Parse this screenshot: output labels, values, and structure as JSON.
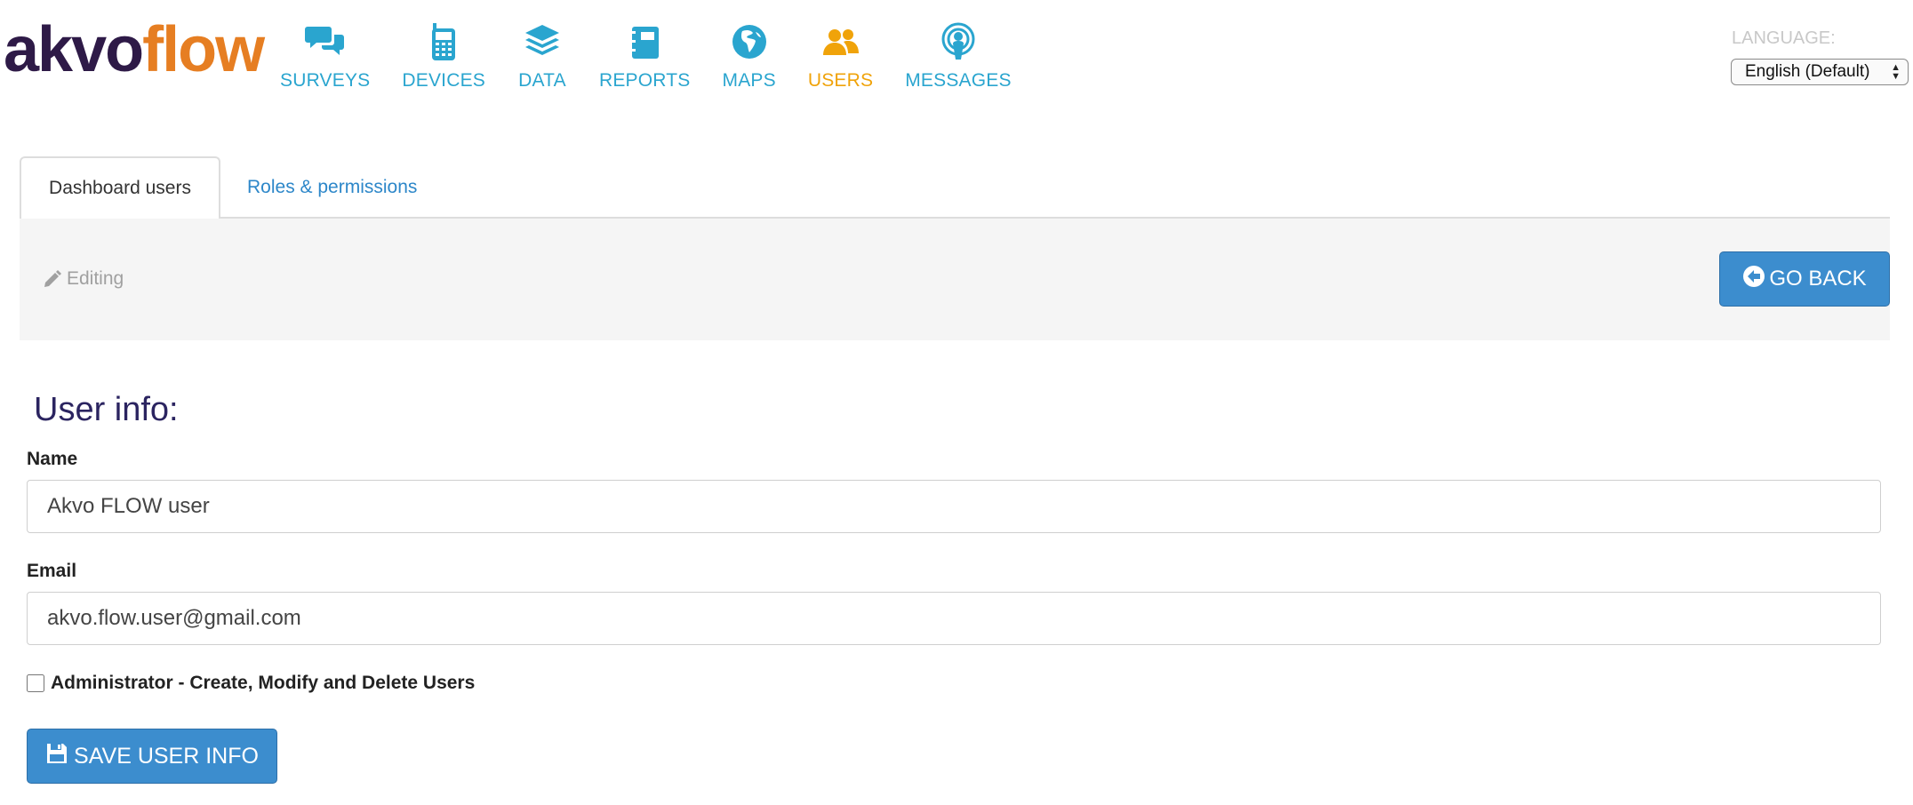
{
  "logo": {
    "part1": "akvo",
    "part2": "flow"
  },
  "nav": {
    "items": [
      {
        "label": "SURVEYS",
        "icon": "surveys-icon"
      },
      {
        "label": "DEVICES",
        "icon": "devices-icon"
      },
      {
        "label": "DATA",
        "icon": "data-icon"
      },
      {
        "label": "REPORTS",
        "icon": "reports-icon"
      },
      {
        "label": "MAPS",
        "icon": "maps-icon"
      },
      {
        "label": "USERS",
        "icon": "users-icon",
        "active": true
      },
      {
        "label": "MESSAGES",
        "icon": "messages-icon"
      }
    ]
  },
  "language": {
    "label": "LANGUAGE:",
    "selected": "English (Default)"
  },
  "tabs": {
    "active": "Dashboard users",
    "other": "Roles & permissions"
  },
  "toolbar": {
    "editing": "Editing",
    "go_back": "GO BACK"
  },
  "form": {
    "title": "User info:",
    "name_label": "Name",
    "name_value": "Akvo FLOW user",
    "email_label": "Email",
    "email_value": "akvo.flow.user@gmail.com",
    "admin_label": "Administrator - Create, Modify and Delete Users",
    "admin_checked": false,
    "save_label": "SAVE USER INFO"
  },
  "colors": {
    "nav_blue": "#2aa5cf",
    "nav_active": "#f0a30a",
    "button_blue": "#3c8dce",
    "logo_dark": "#2e1a47",
    "logo_orange": "#e67e22",
    "title_color": "#2b2460"
  }
}
